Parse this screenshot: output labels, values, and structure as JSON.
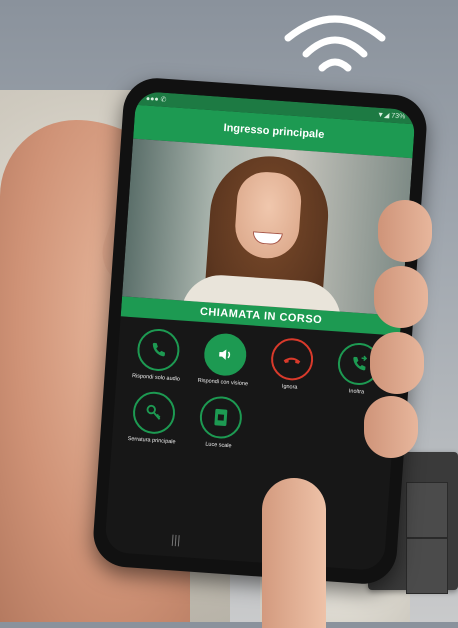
{
  "screen": {
    "status_left": "●●●  ✆",
    "status_right": "▼◢ 73%",
    "title": "Ingresso principale",
    "call_status": "CHIAMATA IN CORSO"
  },
  "controls": [
    {
      "label": "Rispondi solo audio",
      "icon": "phone-icon"
    },
    {
      "label": "Rispondi con visione",
      "icon": "speaker-icon"
    },
    {
      "label": "Ignora",
      "icon": "hangup-icon"
    },
    {
      "label": "Inoltra",
      "icon": "forward-call-icon"
    },
    {
      "label": "Serratura principale",
      "icon": "key-icon"
    },
    {
      "label": "Luce scale",
      "icon": "light-switch-icon"
    }
  ],
  "nav": {
    "recent": "|||",
    "home": "○"
  },
  "colors": {
    "accent": "#1d9a52",
    "reject": "#d93a2b",
    "screen_bg": "#171717"
  }
}
